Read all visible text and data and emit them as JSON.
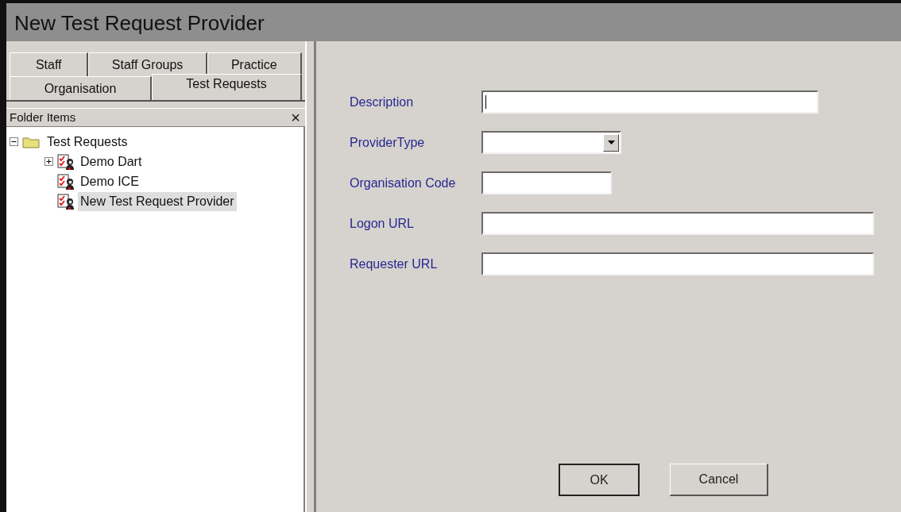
{
  "window": {
    "title": "New Test Request Provider"
  },
  "tab_rows": [
    [
      {
        "label": "Staff",
        "selected": false
      },
      {
        "label": "Staff Groups",
        "selected": false
      },
      {
        "label": "Practice",
        "selected": false
      }
    ],
    [
      {
        "label": "Organisation",
        "selected": false
      },
      {
        "label": "Test Requests",
        "selected": true
      }
    ]
  ],
  "folder_panel": {
    "title": "Folder Items",
    "close": "×"
  },
  "tree": [
    {
      "label": "Test Requests",
      "kind": "folder",
      "expanded": true,
      "selected": false,
      "children": [
        {
          "label": "Demo Dart",
          "kind": "request",
          "expanded": false,
          "selected": false
        },
        {
          "label": "Demo ICE",
          "kind": "request",
          "selected": false
        },
        {
          "label": "New Test Request Provider",
          "kind": "request",
          "selected": true
        }
      ]
    }
  ],
  "form": {
    "fields": [
      {
        "label": "Description",
        "kind": "text",
        "focused": true
      },
      {
        "label": "ProviderType",
        "kind": "select"
      },
      {
        "label": "Organisation Code",
        "kind": "text"
      },
      {
        "label": "Logon URL",
        "kind": "text"
      },
      {
        "label": "Requester URL",
        "kind": "text"
      }
    ]
  },
  "buttons": [
    {
      "label": "OK",
      "default": true
    },
    {
      "label": "Cancel",
      "default": false
    }
  ]
}
